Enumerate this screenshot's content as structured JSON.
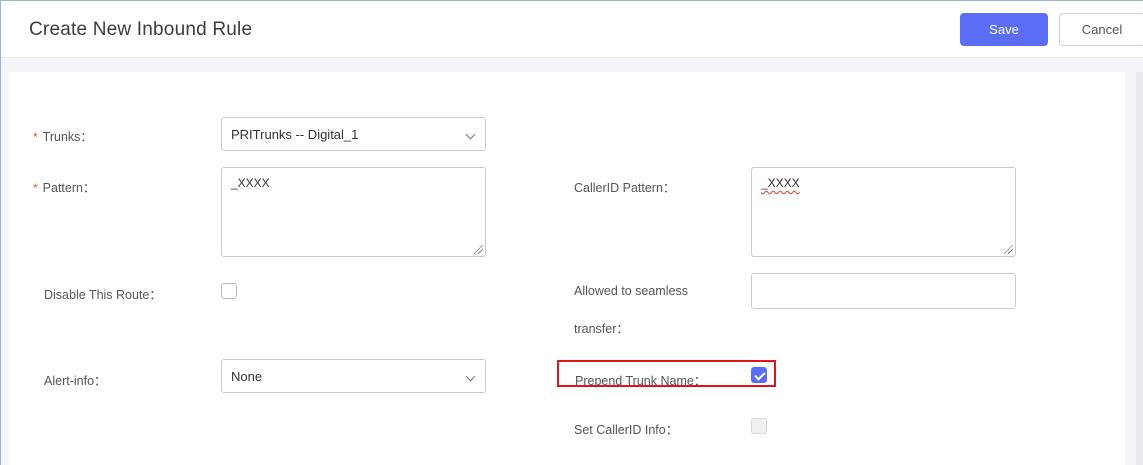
{
  "header": {
    "title": "Create New Inbound Rule",
    "save_label": "Save",
    "cancel_label": "Cancel"
  },
  "form": {
    "required_mark": "*",
    "trunks": {
      "label": "Trunks：",
      "value": "PRITrunks -- Digital_1"
    },
    "pattern": {
      "label": "Pattern：",
      "value": "_XXXX"
    },
    "callerid_pattern": {
      "label": "CallerID Pattern：",
      "value": "_XXXX"
    },
    "disable_route": {
      "label": "Disable This Route：",
      "checked": false
    },
    "seamless_transfer": {
      "label_line1": "Allowed to seamless",
      "label_line2": "transfer：",
      "value": ""
    },
    "alert_info": {
      "label": "Alert-info：",
      "value": "None"
    },
    "prepend_trunk_name": {
      "label": "Prepend Trunk Name：",
      "checked": true
    },
    "set_callerid_info": {
      "label": "Set CallerID Info：",
      "checked": false,
      "disabled": true
    }
  },
  "colors": {
    "accent": "#5b6cf5",
    "required": "#e74c3c",
    "highlight": "#e0141e"
  },
  "icons": [
    "chevron-down-icon",
    "checkmark-icon",
    "resize-grip-icon"
  ]
}
